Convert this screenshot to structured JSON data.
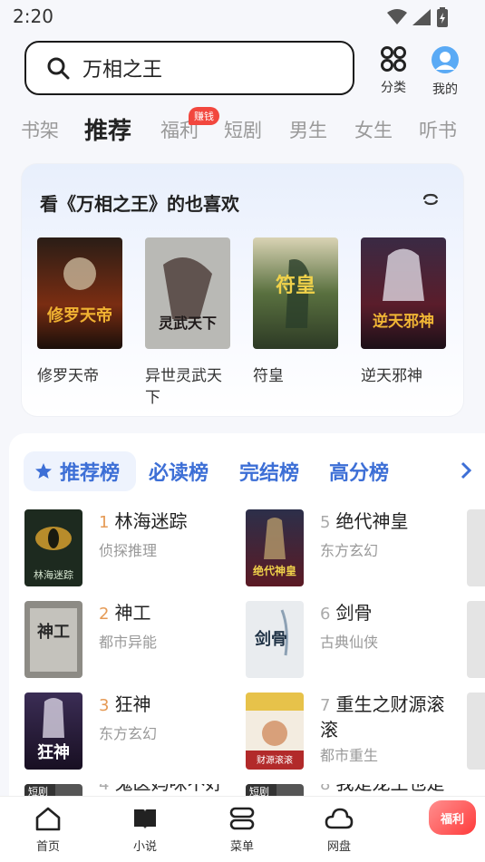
{
  "status": {
    "time": "2:20"
  },
  "search": {
    "query": "万相之王"
  },
  "top_actions": {
    "category": "分类",
    "profile": "我的"
  },
  "channels": [
    "书架",
    "推荐",
    "福利",
    "短剧",
    "男生",
    "女生",
    "听书"
  ],
  "channel_badge": "赚钱",
  "recommend": {
    "title": "看《万相之王》的也喜欢",
    "books": [
      {
        "name": "修罗天帝",
        "cover_text": "修罗天帝"
      },
      {
        "name": "异世灵武天下",
        "cover_text": "灵武天下"
      },
      {
        "name": "符皇",
        "cover_text": "符皇"
      },
      {
        "name": "逆天邪神",
        "cover_text": "逆天邪神"
      }
    ]
  },
  "ranking": {
    "tabs": [
      "推荐榜",
      "必读榜",
      "完结榜",
      "高分榜"
    ],
    "left": [
      {
        "rank": "1",
        "title": "林海迷踪",
        "genre": "侦探推理",
        "cover_text": "林海迷踪"
      },
      {
        "rank": "2",
        "title": "神工",
        "genre": "都市异能",
        "cover_text": "神工"
      },
      {
        "rank": "3",
        "title": "狂神",
        "genre": "东方玄幻",
        "cover_text": "狂神"
      },
      {
        "rank": "4",
        "title": "鬼医妈咪不好",
        "genre": "",
        "cover_text": "短剧"
      }
    ],
    "right": [
      {
        "rank": "5",
        "title": "绝代神皇",
        "genre": "东方玄幻",
        "cover_text": "绝代神皇"
      },
      {
        "rank": "6",
        "title": "剑骨",
        "genre": "古典仙侠",
        "cover_text": "剑骨"
      },
      {
        "rank": "7",
        "title": "重生之财源滚滚",
        "genre": "都市重生",
        "cover_text": "财源滚滚"
      },
      {
        "rank": "8",
        "title": "我是龙王也是",
        "genre": "",
        "cover_text": "短剧"
      }
    ]
  },
  "bottom_nav": [
    "首页",
    "小说",
    "菜单",
    "网盘"
  ],
  "welfare": "福利"
}
